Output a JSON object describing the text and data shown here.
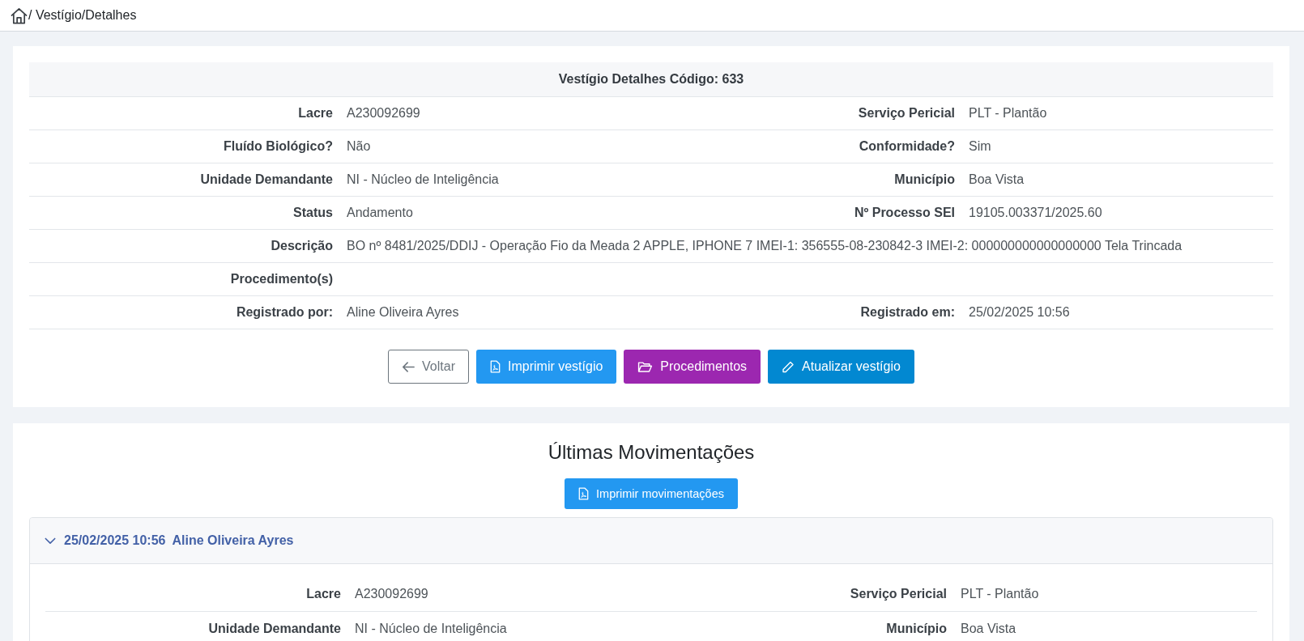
{
  "breadcrumb": {
    "path": "/ Vestígio/Detalhes"
  },
  "details": {
    "title": "Vestígio Detalhes Código: 633",
    "rows": [
      {
        "kind": "pair",
        "cells": [
          {
            "label": "Lacre",
            "value": "A230092699"
          },
          {
            "label": "Serviço Pericial",
            "value": "PLT - Plantão"
          }
        ]
      },
      {
        "kind": "pair",
        "cells": [
          {
            "label": "Fluído Biológico?",
            "value": "Não"
          },
          {
            "label": "Conformidade?",
            "value": "Sim"
          }
        ]
      },
      {
        "kind": "pair",
        "cells": [
          {
            "label": "Unidade Demandante",
            "value": "NI - Núcleo de Inteligência"
          },
          {
            "label": "Município",
            "value": "Boa Vista"
          }
        ]
      },
      {
        "kind": "pair",
        "cells": [
          {
            "label": "Status",
            "value": "Andamento"
          },
          {
            "label": "Nº Processo SEI",
            "value": "19105.003371/2025.60"
          }
        ]
      },
      {
        "kind": "wide",
        "label": "Descrição",
        "value": "BO nº 8481/2025/DDIJ - Operação Fio da Meada 2 APPLE, IPHONE 7 IMEI-1: 356555-08-230842-3 IMEI-2: 000000000000000000 Tela Trincada"
      },
      {
        "kind": "wide",
        "label": "Procedimento(s)"
      },
      {
        "kind": "pair",
        "cells": [
          {
            "label": "Registrado por:",
            "value": "Aline Oliveira Ayres"
          },
          {
            "label": "Registrado em:",
            "value": "25/02/2025 10:56"
          }
        ]
      }
    ]
  },
  "actions": [
    {
      "label": "Voltar",
      "kind": "back"
    },
    {
      "label": "Imprimir vestígio",
      "kind": "print"
    },
    {
      "label": "Procedimentos",
      "kind": "folder"
    },
    {
      "label": "Atualizar vestígio",
      "kind": "edit"
    }
  ],
  "movements": {
    "title": "Últimas Movimentações",
    "print_button": "Imprimir movimentações",
    "entries": [
      {
        "date": "25/02/2025 10:56",
        "user": "Aline Oliveira Ayres",
        "expanded": true,
        "rows": [
          {
            "kind": "pair",
            "cells": [
              {
                "label": "Lacre",
                "value": "A230092699"
              },
              {
                "label": "Serviço Pericial",
                "value": "PLT - Plantão"
              }
            ]
          },
          {
            "kind": "pair",
            "cells": [
              {
                "label": "Unidade Demandante",
                "value": "NI - Núcleo de Inteligência"
              },
              {
                "label": "Município",
                "value": "Boa Vista"
              }
            ]
          }
        ]
      }
    ]
  }
}
